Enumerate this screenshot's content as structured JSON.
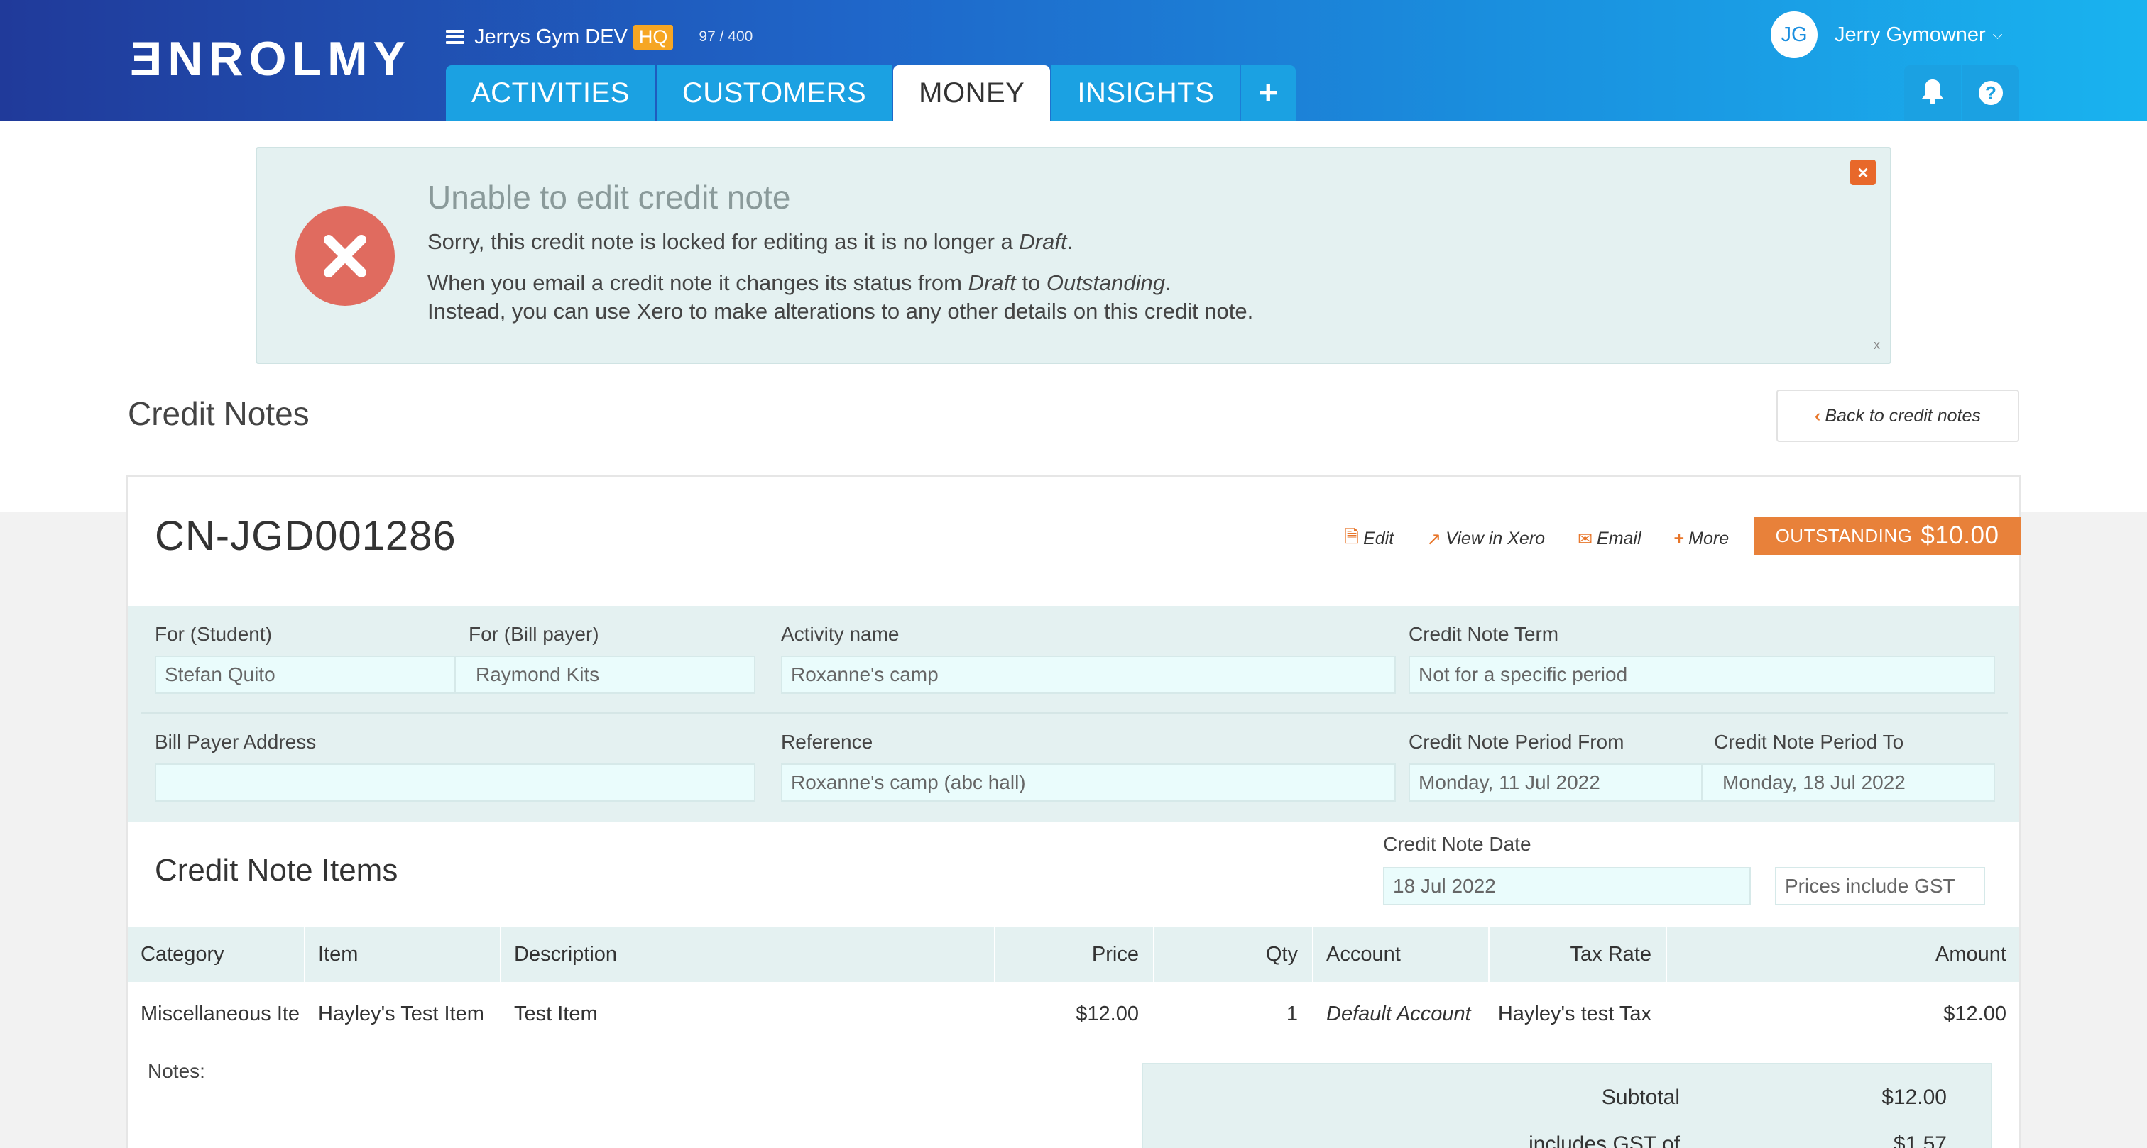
{
  "header": {
    "logo": "ƎNROLMY",
    "org_name": "Jerrys Gym DEV",
    "org_badge": "HQ",
    "usage": "97 / 400",
    "tabs": [
      "ACTIVITIES",
      "CUSTOMERS",
      "MONEY",
      "INSIGHTS",
      "+"
    ],
    "active_tab": "MONEY",
    "user_initials": "JG",
    "user_name": "Jerry Gymowner",
    "help_glyph": "?",
    "icons": [
      "bell-icon",
      "help-icon"
    ],
    "accent": "#1ba1e2"
  },
  "alert": {
    "title": "Unable to edit credit note",
    "line1_prefix": "Sorry, this credit note is locked for editing as it is no longer a ",
    "line1_em": "Draft",
    "line1_suffix": ".",
    "line2_prefix": "When you email a credit note it changes its status from ",
    "line2_em1": "Draft",
    "line2_mid": " to ",
    "line2_em2": "Outstanding",
    "line2_suffix": ".",
    "line3": "Instead, you can use Xero to make alterations to any other details on this credit note.",
    "close_glyph": "×",
    "dismiss_glyph": "x"
  },
  "page": {
    "title": "Credit Notes",
    "back_label": "Back to credit notes"
  },
  "credit_note": {
    "number": "CN-JGD001286",
    "actions": {
      "edit": "Edit",
      "view_in_xero": "View in Xero",
      "email": "Email",
      "more": "More"
    },
    "status": "OUTSTANDING",
    "status_amount": "$10.00",
    "status_color": "#e8813a",
    "fields": {
      "student_label": "For (Student)",
      "student_value": "Stefan Quito",
      "bill_payer_label": "For (Bill payer)",
      "bill_payer_value": "Raymond Kits",
      "activity_label": "Activity name",
      "activity_value": "Roxanne's camp",
      "term_label": "Credit Note Term",
      "term_value": "Not for a specific period",
      "address_label": "Bill Payer Address",
      "address_value": "",
      "reference_label": "Reference",
      "reference_value": "Roxanne's camp (abc hall)",
      "period_from_label": "Credit Note Period From",
      "period_from_value": "Monday, 11 Jul 2022",
      "period_to_label": "Credit Note Period To",
      "period_to_value": "Monday, 18 Jul 2022",
      "date_label": "Credit Note Date",
      "date_value": "18 Jul 2022",
      "gst_value": "Prices include GST"
    },
    "items_title": "Credit Note Items",
    "columns": [
      "Category",
      "Item",
      "Description",
      "Price",
      "Qty",
      "Account",
      "Tax Rate",
      "Amount"
    ],
    "rows": [
      {
        "category": "Miscellaneous Item",
        "item": "Hayley's Test Item",
        "description": "Test Item",
        "price": "$12.00",
        "qty": "1",
        "account": "Default Account",
        "tax_rate": "Hayley's test Tax",
        "amount": "$12.00"
      }
    ],
    "notes_label": "Notes:",
    "totals": {
      "subtotal_label": "Subtotal",
      "subtotal_value": "$12.00",
      "gst_label": "includes GST of",
      "gst_value": "$1.57"
    }
  }
}
